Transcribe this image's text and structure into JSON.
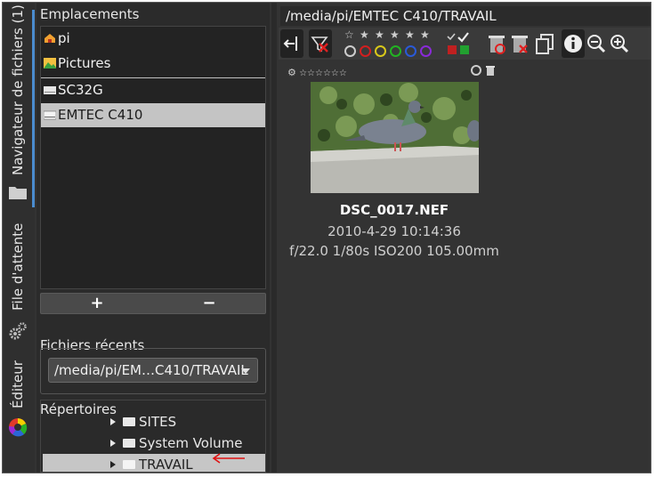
{
  "vertical_tabs": {
    "file_browser_label": "Navigateur de fichiers  (1)",
    "queue_label": "File d'attente",
    "editor_label": "Éditeur"
  },
  "places": {
    "title": "Emplacements",
    "items": [
      {
        "label": "pi",
        "icon": "home-icon"
      },
      {
        "label": "Pictures",
        "icon": "pictures-icon"
      },
      {
        "label": "SC32G",
        "icon": "drive-icon"
      },
      {
        "label": "EMTEC C410",
        "icon": "drive-icon",
        "selected": true
      }
    ],
    "add_label": "+",
    "remove_label": "−"
  },
  "recent": {
    "title": "Fichiers récents",
    "selected_value": "/media/pi/EM…C410/TRAVAIL"
  },
  "directories": {
    "title": "Répertoires",
    "items": [
      {
        "label": "SITES"
      },
      {
        "label": "System Volume In…"
      },
      {
        "label": "TRAVAIL",
        "selected": true
      }
    ]
  },
  "path": "/media/pi/EMTEC C410/TRAVAIL",
  "toolbar": {
    "icons": [
      "toggle-panel-icon",
      "filter-clear-icon",
      "star-rating-filter-icon",
      "color-label-filter-icon",
      "select-all-icon",
      "mark-icon",
      "trash-icon",
      "delete-icon",
      "copy-icon",
      "info-icon",
      "zoom-out-icon",
      "zoom-in-icon"
    ],
    "rating_stars": 6,
    "color_labels": [
      "#cccccc",
      "#d21f1f",
      "#d8c81a",
      "#22b322",
      "#2a5ad8",
      "#8a2ad8"
    ]
  },
  "file": {
    "name": "DSC_0017.NEF",
    "date": "2010-4-29 10:14:36",
    "exif": "f/22.0 1/80s ISO200 105.00mm"
  },
  "colors": {
    "accent": "#4a8ccf",
    "selection": "#c4c4c4",
    "annotation_arrow": "#e01010"
  }
}
